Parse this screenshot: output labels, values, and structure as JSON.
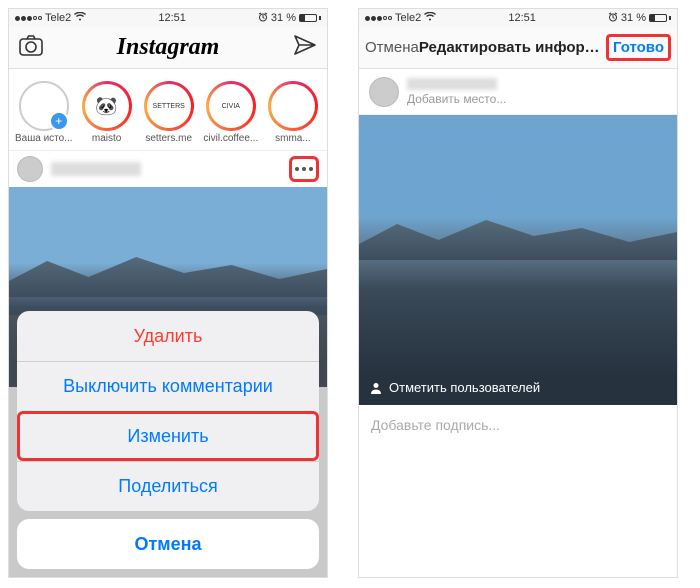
{
  "statusbar": {
    "carrier": "Tele2",
    "time": "12:51",
    "battery_text": "31 %"
  },
  "left": {
    "app_title": "Instagram",
    "stories": [
      {
        "label": "Ваша исто...",
        "ring": "gray",
        "inner": ""
      },
      {
        "label": "maisto",
        "ring": "gradient",
        "inner": "🐼"
      },
      {
        "label": "setters.me",
        "ring": "gradient",
        "inner": "SETTERS"
      },
      {
        "label": "civil.coffee...",
        "ring": "gradient",
        "inner": "CIVIA"
      },
      {
        "label": "smma...",
        "ring": "gradient",
        "inner": ""
      }
    ],
    "action_sheet": {
      "items": [
        {
          "label": "Удалить",
          "style": "destructive"
        },
        {
          "label": "Выключить комментарии",
          "style": "normal"
        },
        {
          "label": "Изменить",
          "style": "highlight"
        },
        {
          "label": "Поделиться",
          "style": "normal"
        }
      ],
      "cancel": "Отмена"
    }
  },
  "right": {
    "cancel": "Отмена",
    "title": "Редактировать информа...",
    "done": "Готово",
    "add_location": "Добавить место...",
    "tag_users": "Отметить пользователей",
    "caption_placeholder": "Добавьте подпись..."
  }
}
